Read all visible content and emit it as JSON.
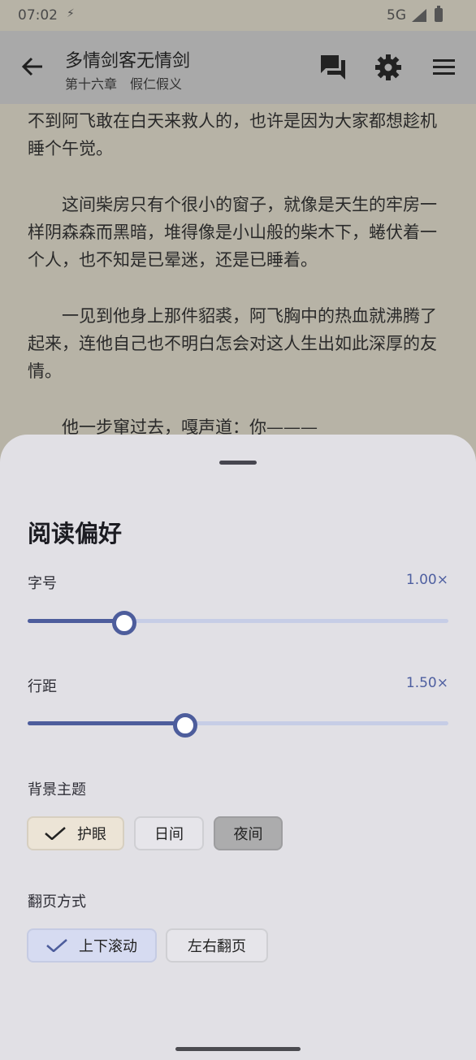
{
  "status_bar": {
    "time": "07:02",
    "network": "5G"
  },
  "app_bar": {
    "book_title": "多情剑客无情剑",
    "chapter": "第十六章　假仁假义"
  },
  "content": {
    "paragraphs": [
      "不到阿飞敢在白天来救人的，也许是因为大家都想趁机睡个午觉。",
      "　　这间柴房只有个很小的窗子，就像是天生的牢房一样阴森森而黑暗，堆得像是小山般的柴木下，蜷伏着一个人，也不知是已晕迷，还是已睡着。",
      "　　一见到他身上那件貂裘，阿飞胸中的热血就沸腾了起来，连他自己也不明白怎会对这人生出如此深厚的友情。",
      "　　他一步窜过去，嘎声道：你———"
    ]
  },
  "sheet": {
    "title": "阅读偏好",
    "font_size": {
      "label": "字号",
      "value": "1.00×",
      "level": 0.23
    },
    "line_spacing": {
      "label": "行距",
      "value": "1.50×",
      "level": 0.375
    },
    "theme": {
      "label": "背景主题",
      "options": [
        "护眼",
        "日间",
        "夜间"
      ],
      "selected": "护眼"
    },
    "page_turn": {
      "label": "翻页方式",
      "options": [
        "上下滚动",
        "左右翻页"
      ],
      "selected": "上下滚动"
    }
  },
  "colors": {
    "accent": "#4d5d9c",
    "sheet_bg": "#e1e0e5",
    "reader_bg": "#b7b3a6"
  },
  "icons": [
    "arrow-back-icon",
    "comments-icon",
    "settings-gear-icon",
    "menu-icon",
    "check-icon"
  ]
}
